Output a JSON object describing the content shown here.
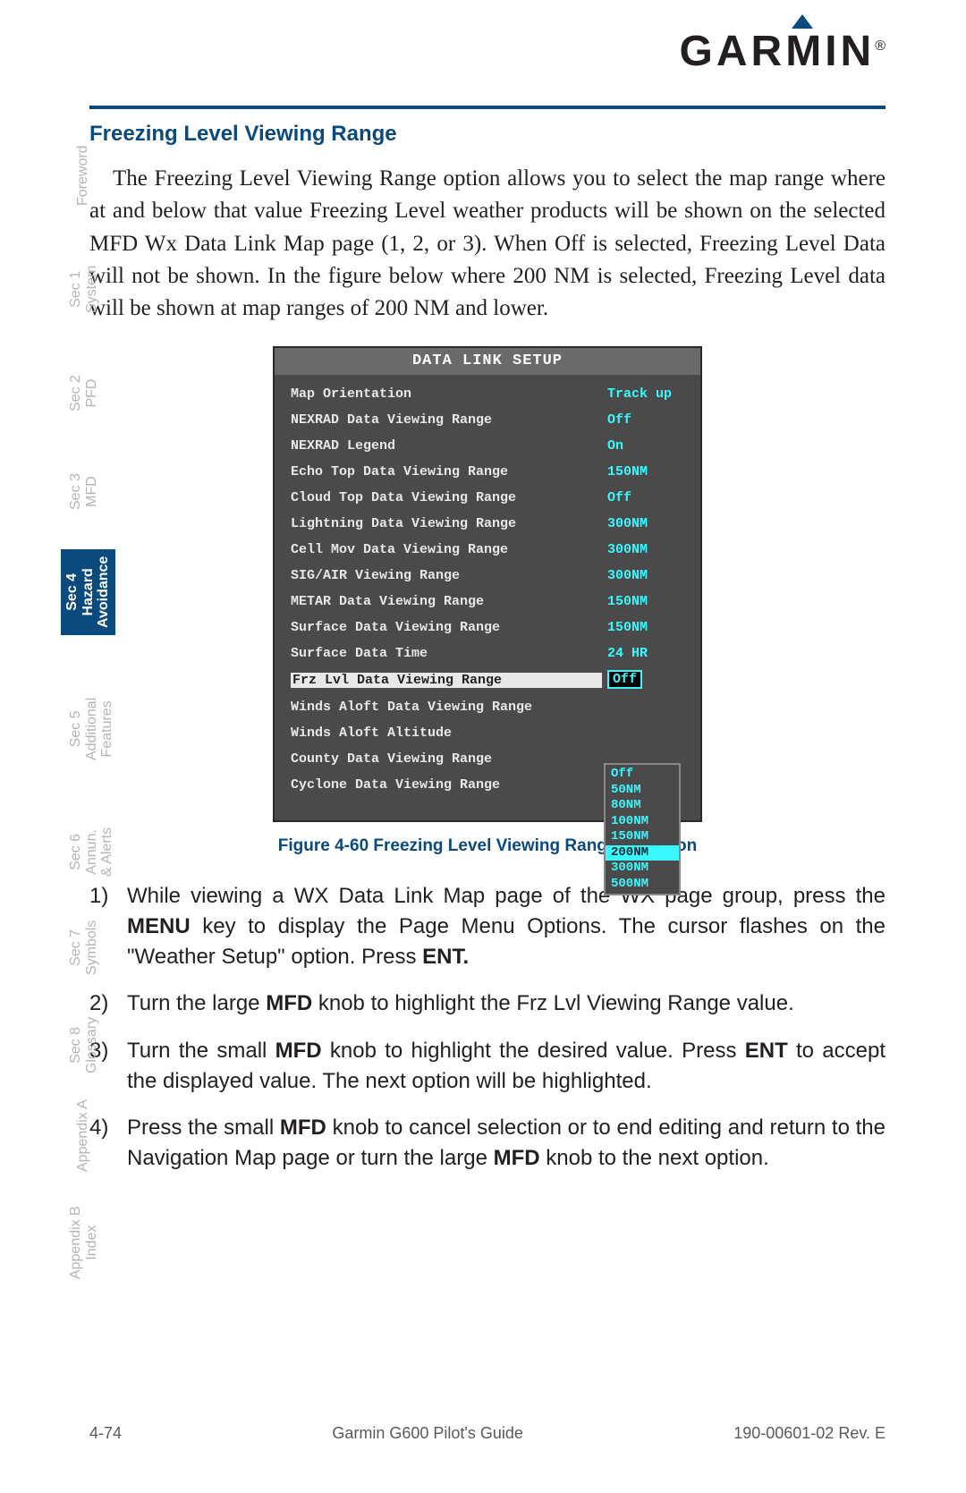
{
  "brand": "GARMIN",
  "section_heading": "Freezing Level Viewing Range",
  "intro_paragraph": "The Freezing Level Viewing Range option allows you to select the map range where at and below that value Freezing Level weather products will be shown on the selected MFD Wx Data Link Map page (1, 2, or 3). When Off is selected, Freezing Level Data will not be shown. In the figure below where 200 NM is selected, Freezing Level data will be shown at map ranges of 200 NM and lower.",
  "figure_caption": "Figure 4-60  Freezing Level Viewing Range Selection",
  "screen": {
    "title": "DATA LINK SETUP",
    "rows": [
      {
        "label": "Map Orientation",
        "value": "Track up",
        "selected": false
      },
      {
        "label": "NEXRAD Data Viewing Range",
        "value": "Off",
        "selected": false
      },
      {
        "label": "NEXRAD Legend",
        "value": "On",
        "selected": false
      },
      {
        "label": "Echo Top Data Viewing Range",
        "value": "150NM",
        "selected": false
      },
      {
        "label": "Cloud Top Data Viewing Range",
        "value": "Off",
        "selected": false
      },
      {
        "label": "Lightning Data Viewing Range",
        "value": "300NM",
        "selected": false
      },
      {
        "label": "Cell Mov Data Viewing Range",
        "value": "300NM",
        "selected": false
      },
      {
        "label": "SIG/AIR Viewing Range",
        "value": "300NM",
        "selected": false
      },
      {
        "label": "METAR Data Viewing Range",
        "value": "150NM",
        "selected": false
      },
      {
        "label": "Surface Data Viewing Range",
        "value": "150NM",
        "selected": false
      },
      {
        "label": "Surface Data Time",
        "value": "24 HR",
        "selected": false
      },
      {
        "label": "Frz Lvl Data Viewing Range",
        "value": "Off",
        "selected": true
      },
      {
        "label": "Winds Aloft Data Viewing Range",
        "value": "",
        "selected": false
      },
      {
        "label": "Winds Aloft Altitude",
        "value": "",
        "selected": false
      },
      {
        "label": "County Data Viewing Range",
        "value": "",
        "selected": false
      },
      {
        "label": "Cyclone Data Viewing Range",
        "value": "",
        "selected": false
      }
    ],
    "dropdown_options": [
      "Off",
      "50NM",
      "80NM",
      "100NM",
      "150NM",
      "200NM",
      "300NM",
      "500NM"
    ],
    "dropdown_highlight": "200NM"
  },
  "steps": [
    {
      "num": "1)",
      "text_before": "While viewing a WX Data Link Map page of the WX page group, press the ",
      "bold1": "MENU",
      "text_mid": " key to display the Page Menu Options. The cursor flashes on the \"Weather Setup\" option. Press ",
      "bold2": "ENT.",
      "text_after": ""
    },
    {
      "num": "2)",
      "text_before": "Turn the large ",
      "bold1": "MFD",
      "text_mid": " knob to highlight the Frz Lvl Viewing Range value.",
      "bold2": "",
      "text_after": ""
    },
    {
      "num": "3)",
      "text_before": "Turn the small ",
      "bold1": "MFD",
      "text_mid": " knob to highlight the desired value. Press ",
      "bold2": "ENT",
      "text_after": " to accept the displayed value. The next option will be highlighted."
    },
    {
      "num": "4)",
      "text_before": "Press the small ",
      "bold1": "MFD",
      "text_mid": " knob to cancel selection or to end editing and return to the Navigation Map page or turn the large ",
      "bold2": "MFD",
      "text_after": " knob to the next option."
    }
  ],
  "sidebar": [
    {
      "label": "Foreword",
      "active": false
    },
    {
      "label": "Sec 1\nSystem",
      "active": false
    },
    {
      "label": "Sec 2\nPFD",
      "active": false
    },
    {
      "label": "Sec 3\nMFD",
      "active": false
    },
    {
      "label": "Sec 4\nHazard\nAvoidance",
      "active": true
    },
    {
      "label": "Sec 5\nAdditional\nFeatures",
      "active": false
    },
    {
      "label": "Sec 6\nAnnun.\n& Alerts",
      "active": false
    },
    {
      "label": "Sec 7\nSymbols",
      "active": false
    },
    {
      "label": "Sec 8\nGlossary",
      "active": false
    },
    {
      "label": "Appendix A",
      "active": false
    },
    {
      "label": "Appendix B\nIndex",
      "active": false
    }
  ],
  "footer": {
    "page_num": "4-74",
    "doc_title": "Garmin G600 Pilot's Guide",
    "doc_rev": "190-00601-02  Rev. E"
  }
}
